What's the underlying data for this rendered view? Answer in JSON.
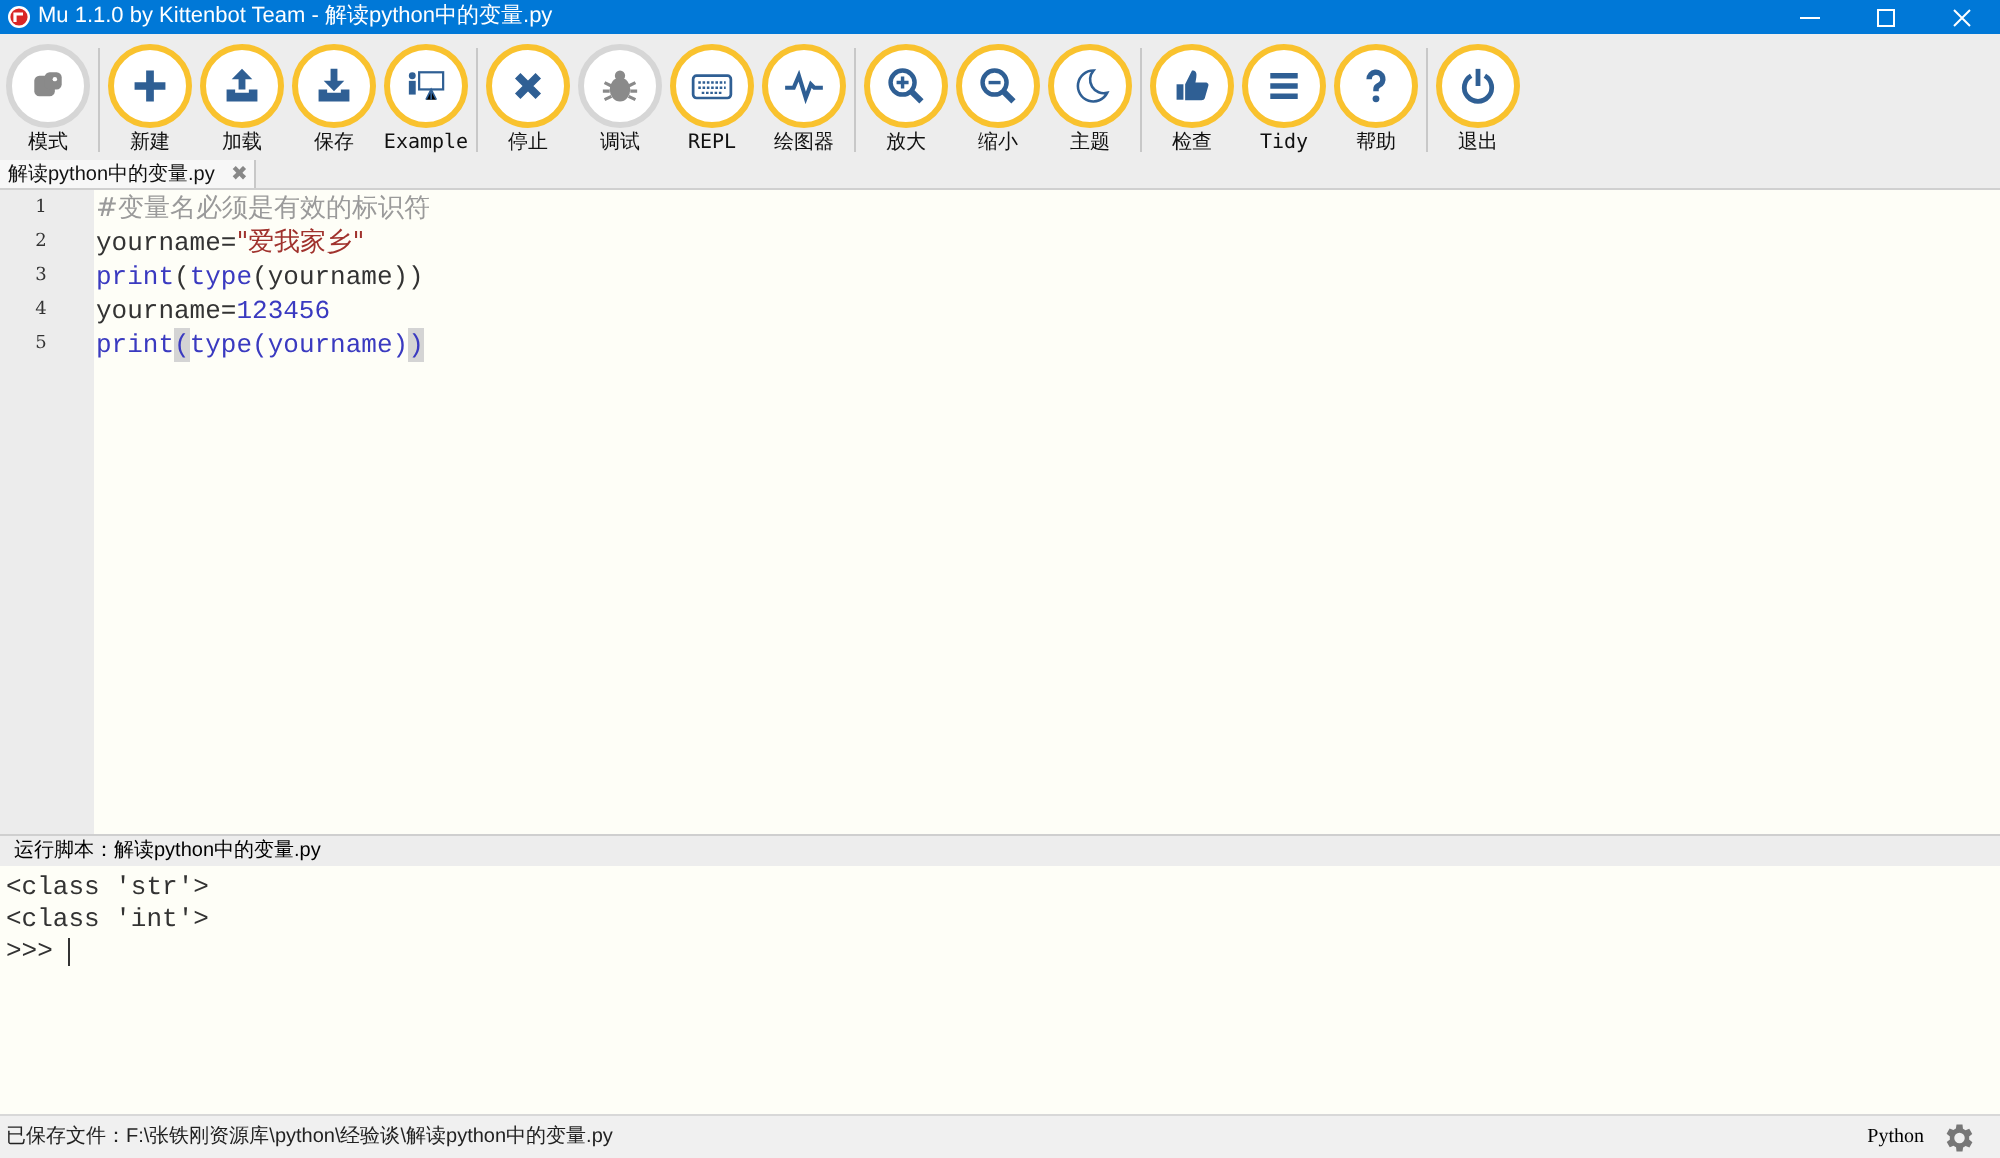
{
  "window": {
    "title": "Mu 1.1.0 by Kittenbot Team - 解读python中的变量.py"
  },
  "toolbar": {
    "groups": [
      {
        "buttons": [
          {
            "kind": "mode",
            "label": "模式",
            "disabled": true
          }
        ]
      },
      {
        "buttons": [
          {
            "kind": "new",
            "label": "新建",
            "disabled": false
          },
          {
            "kind": "load",
            "label": "加载",
            "disabled": false
          },
          {
            "kind": "save",
            "label": "保存",
            "disabled": false
          },
          {
            "kind": "example",
            "label": "Example",
            "disabled": false
          }
        ]
      },
      {
        "buttons": [
          {
            "kind": "stop",
            "label": "停止",
            "disabled": false
          },
          {
            "kind": "debug",
            "label": "调试",
            "disabled": true
          },
          {
            "kind": "repl",
            "label": "REPL",
            "disabled": false
          },
          {
            "kind": "plotter",
            "label": "绘图器",
            "disabled": false
          }
        ]
      },
      {
        "buttons": [
          {
            "kind": "zoom-in",
            "label": "放大",
            "disabled": false
          },
          {
            "kind": "zoom-out",
            "label": "缩小",
            "disabled": false
          },
          {
            "kind": "theme",
            "label": "主题",
            "disabled": false
          }
        ]
      },
      {
        "buttons": [
          {
            "kind": "check",
            "label": "检查",
            "disabled": false
          },
          {
            "kind": "tidy",
            "label": "Tidy",
            "disabled": false
          },
          {
            "kind": "help",
            "label": "帮助",
            "disabled": false
          }
        ]
      },
      {
        "buttons": [
          {
            "kind": "quit",
            "label": "退出",
            "disabled": false
          }
        ]
      }
    ]
  },
  "tabs": [
    {
      "label": "解读python中的变量.py",
      "selected": true,
      "close": "✖"
    }
  ],
  "editor": {
    "lines": [
      {
        "number": "1",
        "tokens": [
          {
            "kind": "comment",
            "text": "#变量名必须是有效的标识符"
          }
        ]
      },
      {
        "number": "2",
        "tokens": [
          {
            "kind": "plain",
            "text": "yourname="
          },
          {
            "kind": "string",
            "text": "\"爱我家乡\""
          }
        ]
      },
      {
        "number": "3",
        "tokens": [
          {
            "kind": "keyword",
            "text": "print"
          },
          {
            "kind": "plain",
            "text": "("
          },
          {
            "kind": "keyword",
            "text": "type"
          },
          {
            "kind": "plain",
            "text": "(yourname))"
          }
        ]
      },
      {
        "number": "4",
        "tokens": [
          {
            "kind": "plain",
            "text": "yourname="
          },
          {
            "kind": "number",
            "text": "123456"
          }
        ]
      },
      {
        "number": "5",
        "tokens": [
          {
            "kind": "keyword",
            "text": "print"
          },
          {
            "kind": "match",
            "text": "("
          },
          {
            "kind": "keyword",
            "text": "type"
          },
          {
            "kind": "keyword",
            "text": "(yourname)"
          },
          {
            "kind": "match",
            "text": ")"
          }
        ]
      }
    ]
  },
  "output": {
    "header": "运行脚本：解读python中的变量.py",
    "lines": [
      "<class 'str'>",
      "<class 'int'>",
      ">>> "
    ]
  },
  "status_bar": {
    "message": "已保存文件：F:\\张铁刚资源库\\python\\经验谈\\解读python中的变量.py",
    "mode": "Python"
  }
}
